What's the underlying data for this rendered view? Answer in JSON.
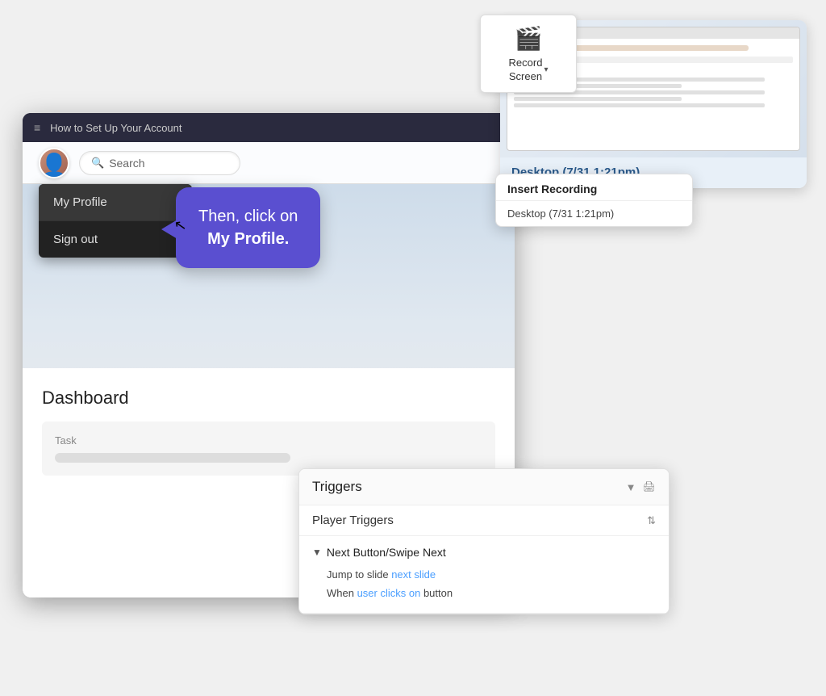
{
  "record_screen": {
    "label": "Record\nScreen",
    "dropdown_arrow": "▾",
    "icon": "🎥"
  },
  "desktop_card": {
    "title": "Desktop (7/31 1:21pm)"
  },
  "insert_recording": {
    "header": "Insert Recording",
    "item": "Desktop (7/31 1:21pm)"
  },
  "browser": {
    "menu_icon": "≡",
    "title": "How to Set Up Your Account"
  },
  "header": {
    "search_placeholder": "Search"
  },
  "dropdown": {
    "items": [
      {
        "label": "My Profile",
        "highlighted": true
      },
      {
        "label": "Sign out",
        "highlighted": false
      }
    ]
  },
  "callout": {
    "line1": "Then, click on",
    "line2": "My Profile."
  },
  "dashboard": {
    "title": "Dashboard",
    "task_label": "Task"
  },
  "triggers": {
    "title": "Triggers",
    "player_triggers": "Player Triggers",
    "trigger_item": "Next Button/Swipe Next",
    "action1_prefix": "Jump to slide ",
    "action1_link": "next slide",
    "action2_prefix": "When ",
    "action2_link1": "user clicks on",
    "action2_link2": " button"
  }
}
